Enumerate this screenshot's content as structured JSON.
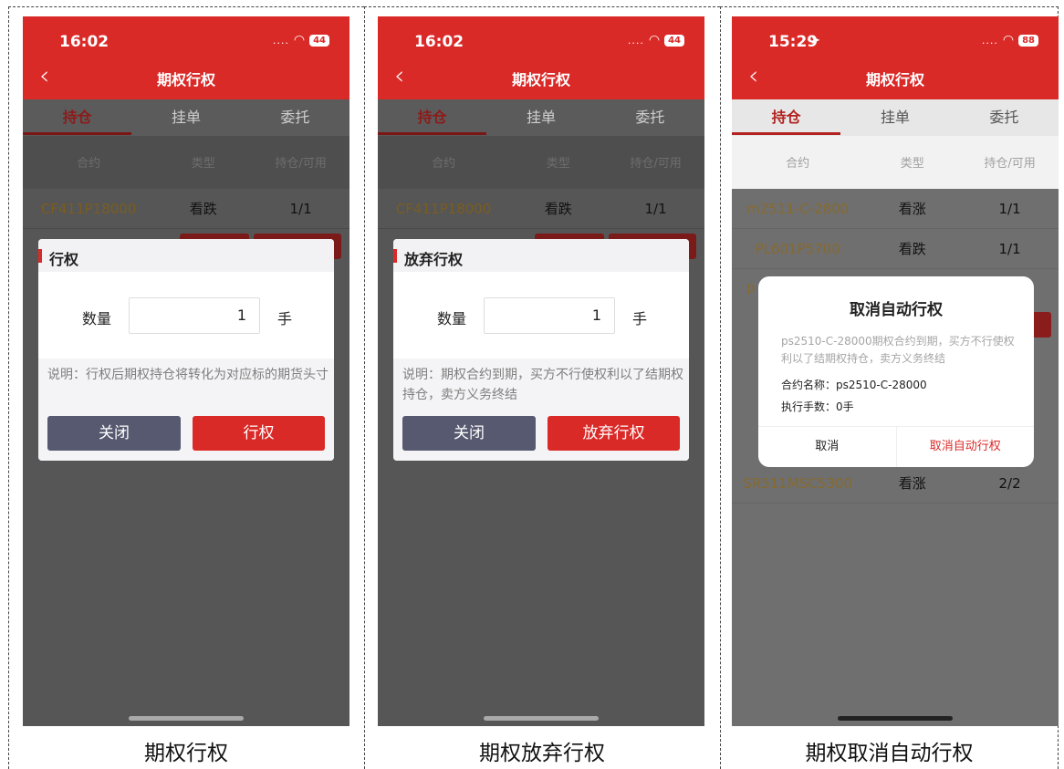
{
  "panels": [
    {
      "status_time": "16:02",
      "status_dots": "....",
      "battery": "44",
      "nav_title": "期权行权",
      "tabs": [
        "持仓",
        "挂单",
        "委托"
      ],
      "columns": [
        "合约",
        "类型",
        "持仓/可用"
      ],
      "rows": [
        {
          "contract": "CF411P18000",
          "type": "看跌",
          "holding": "1/1"
        }
      ],
      "dialog": {
        "title": "行权",
        "qty_label": "数量",
        "qty_value": "1",
        "qty_unit": "手",
        "note": "说明：行权后期权持仓将转化为对应标的期货头寸",
        "close_label": "关闭",
        "confirm_label": "行权"
      },
      "caption": "期权行权"
    },
    {
      "status_time": "16:02",
      "status_dots": "....",
      "battery": "44",
      "nav_title": "期权行权",
      "tabs": [
        "持仓",
        "挂单",
        "委托"
      ],
      "columns": [
        "合约",
        "类型",
        "持仓/可用"
      ],
      "rows": [
        {
          "contract": "CF411P18000",
          "type": "看跌",
          "holding": "1/1"
        }
      ],
      "dialog": {
        "title": "放弃行权",
        "qty_label": "数量",
        "qty_value": "1",
        "qty_unit": "手",
        "note": "说明：期权合约到期，买方不行使权利以了结期权持仓，卖方义务终结",
        "close_label": "关闭",
        "confirm_label": "放弃行权"
      },
      "caption": "期权放弃行权"
    },
    {
      "status_time": "15:29",
      "status_dots": "....",
      "battery": "88",
      "nav_title": "期权行权",
      "tabs": [
        "持仓",
        "挂单",
        "委托"
      ],
      "columns": [
        "合约",
        "类型",
        "持仓/可用"
      ],
      "rows": [
        {
          "contract": "m2511-C-2800",
          "type": "看涨",
          "holding": "1/1"
        },
        {
          "contract": "PL601P5700",
          "type": "看跌",
          "holding": "1/1"
        },
        {
          "contract": "SR511MSC5300",
          "type": "看涨",
          "holding": "2/2"
        }
      ],
      "partial_row_text": "p",
      "alert": {
        "title": "取消自动行权",
        "desc": "ps2510-C-28000期权合约到期，买方不行使权利以了结期权持仓，卖方义务终结",
        "contract_line": "合约名称：ps2510-C-28000",
        "qty_line": "执行手数：0手",
        "cancel_label": "取消",
        "confirm_label": "取消自动行权"
      },
      "caption": "期权取消自动行权"
    }
  ],
  "colors": {
    "brand_red": "#da2a28",
    "dim_bg": "#565656",
    "close_btn": "#575970",
    "contract_gold": "#7a5d1f"
  }
}
